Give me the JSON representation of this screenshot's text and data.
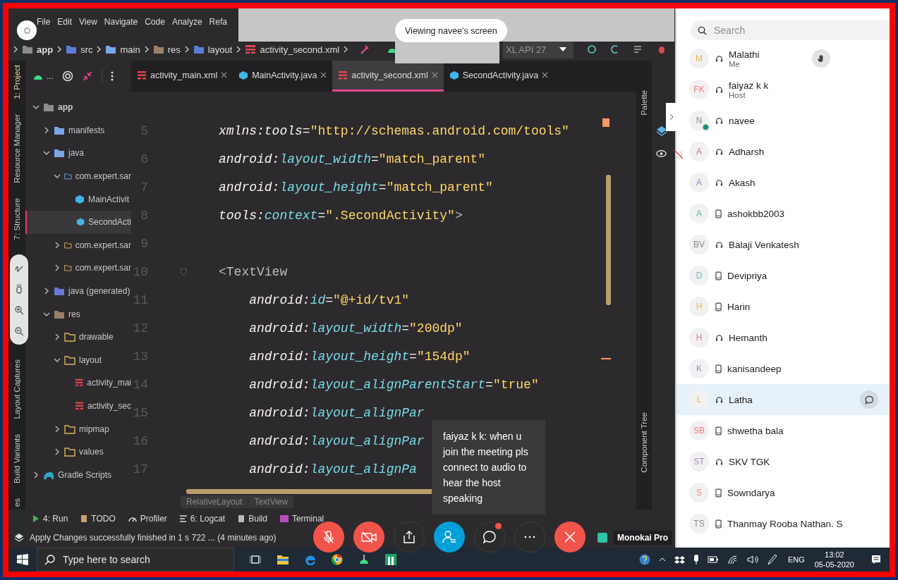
{
  "ide": {
    "menu": [
      "File",
      "Edit",
      "View",
      "Navigate",
      "Code",
      "Analyze",
      "Refa"
    ],
    "breadcrumb": [
      {
        "label": "app",
        "kind": "module"
      },
      {
        "label": "src",
        "kind": "source"
      },
      {
        "label": "main",
        "kind": "folder"
      },
      {
        "label": "res",
        "kind": "res"
      },
      {
        "label": "layout",
        "kind": "layout"
      },
      {
        "label": "activity_second.xml",
        "kind": "xml"
      }
    ],
    "device": "XL API 27",
    "left_stripe": [
      "1: Project",
      "Resource Manager",
      "7: Structure",
      "Layout Captures",
      "Build Variants",
      "es"
    ],
    "project": {
      "view_selector": "...",
      "tree": [
        {
          "label": "app",
          "kind": "module",
          "expanded": true,
          "selected": false,
          "children": [
            {
              "label": "manifests",
              "kind": "folder",
              "expanded": false,
              "selected": false
            },
            {
              "label": "java",
              "kind": "folder",
              "expanded": true,
              "selected": false,
              "children": [
                {
                  "label": "com.expert.sar",
                  "kind": "package",
                  "expanded": true,
                  "selected": false,
                  "children": [
                    {
                      "label": "MainActivit",
                      "kind": "java",
                      "selected": false
                    },
                    {
                      "label": "SecondActi",
                      "kind": "java",
                      "selected": true
                    }
                  ]
                },
                {
                  "label": "com.expert.sar",
                  "kind": "res-folder",
                  "expanded": false,
                  "selected": false
                },
                {
                  "label": "com.expert.sar",
                  "kind": "res-folder",
                  "expanded": false,
                  "selected": false
                }
              ]
            },
            {
              "label": "java (generated)",
              "kind": "generated",
              "expanded": false,
              "selected": false
            },
            {
              "label": "res",
              "kind": "res",
              "expanded": true,
              "selected": false,
              "children": [
                {
                  "label": "drawable",
                  "kind": "res-folder",
                  "expanded": false,
                  "selected": false
                },
                {
                  "label": "layout",
                  "kind": "res-folder",
                  "expanded": true,
                  "selected": false,
                  "children": [
                    {
                      "label": "activity_mai",
                      "kind": "xml",
                      "selected": false
                    },
                    {
                      "label": "activity_sec",
                      "kind": "xml",
                      "selected": false
                    }
                  ]
                },
                {
                  "label": "mipmap",
                  "kind": "res-folder",
                  "expanded": false,
                  "selected": false
                },
                {
                  "label": "values",
                  "kind": "res-folder",
                  "expanded": false,
                  "selected": false
                }
              ]
            }
          ]
        },
        {
          "label": "Gradle Scripts",
          "kind": "gradle",
          "expanded": false,
          "selected": false
        }
      ]
    },
    "tabs": [
      {
        "label": "activity_main.xml",
        "kind": "xml",
        "selected": false
      },
      {
        "label": "MainActivity.java",
        "kind": "java",
        "selected": false
      },
      {
        "label": "activity_second.xml",
        "kind": "xml",
        "selected": true
      },
      {
        "label": "SecondActivity.java",
        "kind": "java",
        "selected": false
      }
    ],
    "code_lines": [
      {
        "number": "5",
        "parts": [
          {
            "kind": "ns",
            "text": "xmlns:tools"
          },
          {
            "kind": "punct",
            "text": "="
          },
          {
            "kind": "str",
            "text": "\"http://schemas.android.com/tools\""
          }
        ]
      },
      {
        "number": "6",
        "parts": [
          {
            "kind": "ns",
            "text": "android:"
          },
          {
            "kind": "attr",
            "text": "layout_width"
          },
          {
            "kind": "punct",
            "text": "="
          },
          {
            "kind": "str",
            "text": "\"match_parent\""
          }
        ]
      },
      {
        "number": "7",
        "parts": [
          {
            "kind": "ns",
            "text": "android:"
          },
          {
            "kind": "attr",
            "text": "layout_height"
          },
          {
            "kind": "punct",
            "text": "="
          },
          {
            "kind": "str",
            "text": "\"match_parent\""
          }
        ]
      },
      {
        "number": "8",
        "parts": [
          {
            "kind": "ns",
            "text": "tools:"
          },
          {
            "kind": "attr",
            "text": "context"
          },
          {
            "kind": "punct",
            "text": "="
          },
          {
            "kind": "str",
            "text": "\".SecondActivity\""
          },
          {
            "kind": "tag",
            "text": ">"
          }
        ]
      },
      {
        "number": "9"
      },
      {
        "number": "10",
        "parts": [
          {
            "kind": "tag",
            "text": "<TextView"
          }
        ]
      },
      {
        "number": "11",
        "parts": [
          {
            "kind": "ns",
            "text": "    android:"
          },
          {
            "kind": "attr",
            "text": "id"
          },
          {
            "kind": "punct",
            "text": "="
          },
          {
            "kind": "str",
            "text": "\"@+id/tv1\""
          }
        ]
      },
      {
        "number": "12",
        "parts": [
          {
            "kind": "ns",
            "text": "    android:"
          },
          {
            "kind": "attr",
            "text": "layout_width"
          },
          {
            "kind": "punct",
            "text": "="
          },
          {
            "kind": "str",
            "text": "\"200dp\""
          }
        ]
      },
      {
        "number": "13",
        "parts": [
          {
            "kind": "ns",
            "text": "    android:"
          },
          {
            "kind": "attr",
            "text": "layout_height"
          },
          {
            "kind": "punct",
            "text": "="
          },
          {
            "kind": "str",
            "text": "\"154dp\""
          }
        ]
      },
      {
        "number": "14",
        "parts": [
          {
            "kind": "ns",
            "text": "    android:"
          },
          {
            "kind": "attr",
            "text": "layout_alignParentStart"
          },
          {
            "kind": "punct",
            "text": "="
          },
          {
            "kind": "str",
            "text": "\"true\""
          }
        ]
      },
      {
        "number": "15",
        "parts": [
          {
            "kind": "ns",
            "text": "    android:"
          },
          {
            "kind": "attr",
            "text": "layout_alignPar"
          }
        ]
      },
      {
        "number": "16",
        "parts": [
          {
            "kind": "ns",
            "text": "    android:"
          },
          {
            "kind": "attr",
            "text": "layout_alignPar"
          }
        ]
      },
      {
        "number": "17",
        "parts": [
          {
            "kind": "ns",
            "text": "    android:"
          },
          {
            "kind": "attr",
            "text": "layout_alignPa"
          }
        ]
      }
    ],
    "editor_breadcrumb": [
      "RelativeLayout",
      "TextView"
    ],
    "right_stripe": [
      "Palette",
      "Component Tree"
    ],
    "tool_windows": [
      {
        "label": "4: Run",
        "kind": "run"
      },
      {
        "label": "TODO",
        "kind": "todo"
      },
      {
        "label": "Profiler",
        "kind": "profiler"
      },
      {
        "label": "6: Logcat",
        "kind": "logcat"
      },
      {
        "label": "Build",
        "kind": "build"
      },
      {
        "label": "Terminal",
        "kind": "terminal"
      }
    ],
    "status": "Apply Changes successfully finished in 1 s 722 ... (4 minutes ago)",
    "theme": "Monokai Pro"
  },
  "screen_share": {
    "banner": "Viewing navee's screen"
  },
  "chat_popup": {
    "text": "faiyaz k k: when u join the meeting pls connect to audio to hear the host speaking"
  },
  "meeting_controls": [
    {
      "kind": "mute",
      "unread": false
    },
    {
      "kind": "video",
      "unread": false
    },
    {
      "kind": "share",
      "unread": false
    },
    {
      "kind": "participants",
      "unread": false
    },
    {
      "kind": "chat",
      "unread": true
    },
    {
      "kind": "more",
      "unread": false
    },
    {
      "kind": "leave",
      "unread": false
    }
  ],
  "participants": {
    "search": {
      "placeholder": "Search"
    },
    "people": [
      {
        "initials": "M",
        "color": "#e8b84a",
        "name": "Malathi",
        "role": "Me",
        "kind": "headset",
        "hand_raised": true,
        "sharing": false,
        "selected": false
      },
      {
        "initials": "FK",
        "color": "#ec7b7b",
        "name": "faiyaz k k",
        "role": "Host",
        "kind": "headset",
        "hand_raised": false,
        "sharing": false,
        "selected": false
      },
      {
        "initials": "N",
        "color": "#8a8a8a",
        "name": "navee",
        "kind": "headset",
        "hand_raised": false,
        "sharing": true,
        "selected": false
      },
      {
        "initials": "A",
        "color": "#e0707a",
        "name": "Adharsh",
        "kind": "headset",
        "hand_raised": false,
        "sharing": false,
        "selected": false
      },
      {
        "initials": "A",
        "color": "#a77fc4",
        "name": "Akash",
        "kind": "headset",
        "hand_raised": false,
        "sharing": false,
        "selected": false
      },
      {
        "initials": "A",
        "color": "#5bb8a0",
        "name": "ashokbb2003",
        "kind": "phone",
        "hand_raised": false,
        "sharing": false,
        "selected": false
      },
      {
        "initials": "BV",
        "color": "#8a8a8a",
        "name": "Balaji Venkatesh",
        "kind": "headset",
        "hand_raised": false,
        "sharing": false,
        "selected": false
      },
      {
        "initials": "D",
        "color": "#5bc0b8",
        "name": "Devipriya",
        "kind": "phone",
        "hand_raised": false,
        "sharing": false,
        "selected": false
      },
      {
        "initials": "H",
        "color": "#e8b84a",
        "name": "Harin",
        "kind": "phone",
        "hand_raised": false,
        "sharing": false,
        "selected": false
      },
      {
        "initials": "H",
        "color": "#ec7b7b",
        "name": "Hemanth",
        "kind": "headset",
        "hand_raised": false,
        "sharing": false,
        "selected": false
      },
      {
        "initials": "K",
        "color": "#a77fc4",
        "name": "kanisandeep",
        "kind": "phone",
        "hand_raised": false,
        "sharing": false,
        "selected": false
      },
      {
        "initials": "L",
        "color": "#e8b84a",
        "name": "Latha",
        "kind": "headset",
        "hand_raised": false,
        "sharing": false,
        "selected": true
      },
      {
        "initials": "SB",
        "color": "#ec7b7b",
        "name": "shwetha bala",
        "kind": "phone",
        "hand_raised": false,
        "sharing": false,
        "selected": false
      },
      {
        "initials": "ST",
        "color": "#a77fc4",
        "name": "SKV TGK",
        "kind": "headset",
        "hand_raised": false,
        "sharing": false,
        "selected": false
      },
      {
        "initials": "S",
        "color": "#ef8a6a",
        "name": "Sowndarya",
        "kind": "phone",
        "hand_raised": false,
        "sharing": false,
        "selected": false
      },
      {
        "initials": "TS",
        "color": "#8a8a8a",
        "name": "Thanmay Rooba Nathan. S",
        "kind": "phone",
        "hand_raised": false,
        "sharing": false,
        "selected": false
      }
    ]
  },
  "taskbar": {
    "search": {
      "placeholder": "Type here to search"
    },
    "language": "ENG",
    "time": "13:02",
    "date": "05-05-2020"
  }
}
